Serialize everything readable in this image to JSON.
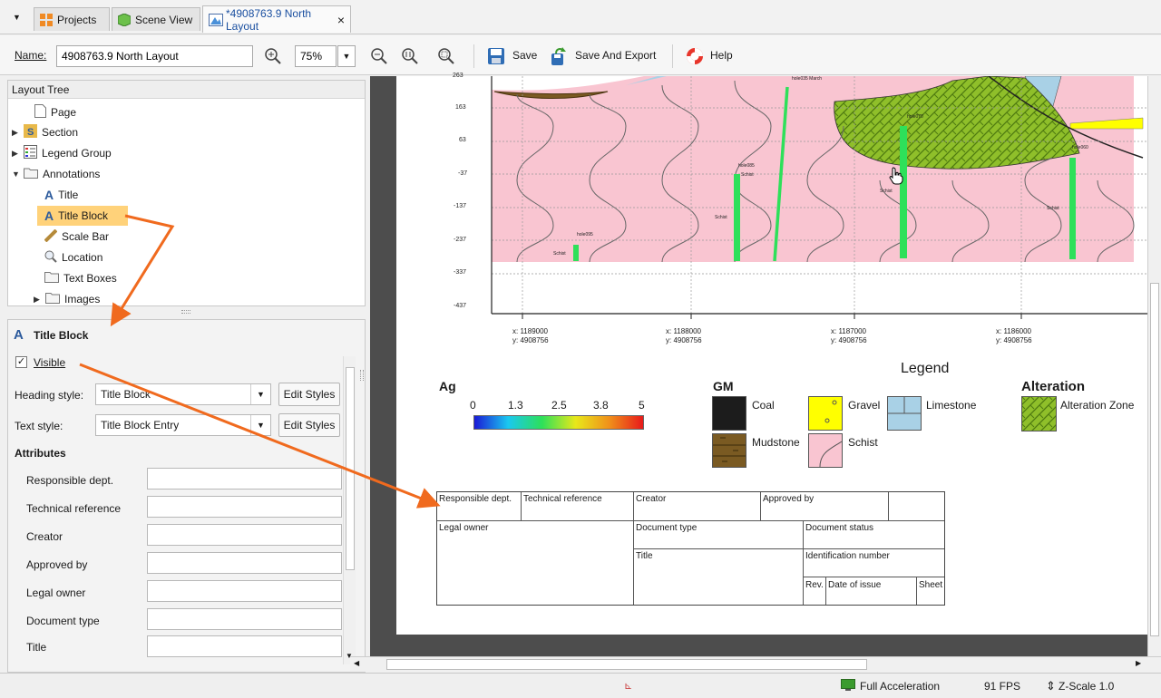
{
  "tabs": {
    "projects": "Projects",
    "scene_view": "Scene View",
    "layout": "*4908763.9 North Layout",
    "close": "×"
  },
  "toolbar": {
    "name_label": "Name:",
    "name_value": "4908763.9 North Layout",
    "zoom": "75%",
    "save": "Save",
    "save_export": "Save And Export",
    "help": "Help"
  },
  "tree": {
    "header": "Layout Tree",
    "items": [
      "Page",
      "Section",
      "Legend Group",
      "Annotations",
      "Title",
      "Title Block",
      "Scale Bar",
      "Location",
      "Text Boxes",
      "Images"
    ]
  },
  "props": {
    "title": "Title Block",
    "visible": "Visible",
    "heading_style_label": "Heading style:",
    "heading_style_value": "Title Block",
    "text_style_label": "Text style:",
    "text_style_value": "Title Block Entry",
    "edit_styles": "Edit Styles",
    "attributes": "Attributes",
    "fields": [
      "Responsible dept.",
      "Technical reference",
      "Creator",
      "Approved by",
      "Legal owner",
      "Document type",
      "Title"
    ]
  },
  "section": {
    "y_ticks": [
      "263",
      "163",
      "63",
      "-37",
      "-137",
      "-237",
      "-337",
      "-437"
    ],
    "coords": [
      {
        "x": "x: 1189000",
        "y": "y: 4908756"
      },
      {
        "x": "x: 1188000",
        "y": "y: 4908756"
      },
      {
        "x": "x: 1187000",
        "y": "y: 4908756"
      },
      {
        "x": "x: 1186000",
        "y": "y: 4908756"
      }
    ],
    "hole_labels": [
      "hole095",
      "hole085",
      "hole035 March",
      "hole070",
      "hole060"
    ],
    "schist_labels": [
      "Schist",
      "Schist",
      "Schist",
      "Schist",
      "Schist"
    ]
  },
  "legend": {
    "title": "Legend",
    "ag_label": "Ag",
    "ag_ticks": [
      "0",
      "1.3",
      "2.5",
      "3.8",
      "5"
    ],
    "gm_label": "GM",
    "gm_items": [
      "Coal",
      "Gravel",
      "Limestone",
      "Mudstone",
      "Schist"
    ],
    "alteration_label": "Alteration",
    "alteration_item": "Alteration Zone"
  },
  "title_block": {
    "responsible": "Responsible dept.",
    "technical": "Technical reference",
    "creator": "Creator",
    "approved": "Approved by",
    "legal": "Legal owner",
    "doc_type": "Document type",
    "doc_status": "Document status",
    "title": "Title",
    "ident": "Identification number",
    "rev": "Rev.",
    "date": "Date of issue",
    "sheet": "Sheet"
  },
  "status": {
    "accel": "Full Acceleration",
    "fps": "91 FPS",
    "zscale": "Z-Scale 1.0"
  },
  "colors": {
    "schist": "#f9c5d1",
    "alteration": "#8fbf2a",
    "selected": "#ffd27a",
    "arrow": "#f06a1e",
    "hole": "#2ee05a"
  }
}
